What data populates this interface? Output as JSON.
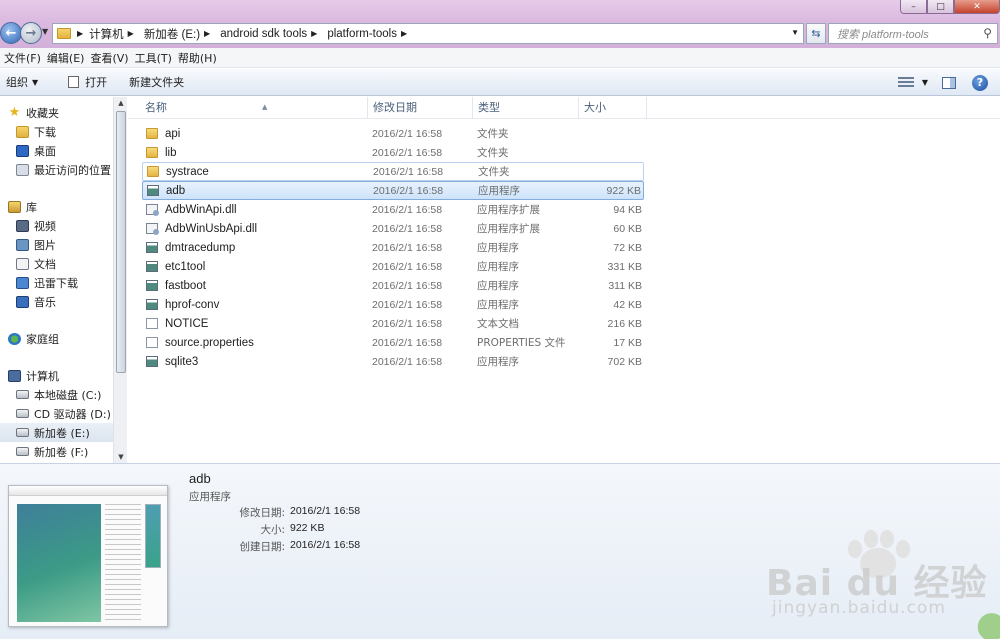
{
  "address": {
    "crumbs": [
      "计算机",
      "新加卷 (E:)",
      "android sdk tools",
      "platform-tools"
    ],
    "search_placeholder": "搜索 platform-tools"
  },
  "menu": [
    "文件(F)",
    "编辑(E)",
    "查看(V)",
    "工具(T)",
    "帮助(H)"
  ],
  "toolbar": {
    "organize": "组织",
    "open": "打开",
    "new_folder": "新建文件夹"
  },
  "sidebar": {
    "favorites_label": "收藏夹",
    "favorites": [
      "下载",
      "桌面",
      "最近访问的位置"
    ],
    "libraries_label": "库",
    "libraries": [
      "视频",
      "图片",
      "文档",
      "迅雷下载",
      "音乐"
    ],
    "homegroup_label": "家庭组",
    "computer_label": "计算机",
    "drives": [
      "本地磁盘 (C:)",
      "CD 驱动器 (D:)",
      "新加卷 (E:)",
      "新加卷 (F:)"
    ]
  },
  "columns": {
    "name": "名称",
    "date": "修改日期",
    "type": "类型",
    "size": "大小"
  },
  "files": [
    {
      "name": "api",
      "date": "2016/2/1 16:58",
      "type": "文件夹",
      "size": "",
      "icon": "folder-icon"
    },
    {
      "name": "lib",
      "date": "2016/2/1 16:58",
      "type": "文件夹",
      "size": "",
      "icon": "folder-icon"
    },
    {
      "name": "systrace",
      "date": "2016/2/1 16:58",
      "type": "文件夹",
      "size": "",
      "icon": "folder-icon"
    },
    {
      "name": "adb",
      "date": "2016/2/1 16:58",
      "type": "应用程序",
      "size": "922 KB",
      "icon": "exe-icon"
    },
    {
      "name": "AdbWinApi.dll",
      "date": "2016/2/1 16:58",
      "type": "应用程序扩展",
      "size": "94 KB",
      "icon": "dll-icon"
    },
    {
      "name": "AdbWinUsbApi.dll",
      "date": "2016/2/1 16:58",
      "type": "应用程序扩展",
      "size": "60 KB",
      "icon": "dll-icon"
    },
    {
      "name": "dmtracedump",
      "date": "2016/2/1 16:58",
      "type": "应用程序",
      "size": "72 KB",
      "icon": "exe-icon"
    },
    {
      "name": "etc1tool",
      "date": "2016/2/1 16:58",
      "type": "应用程序",
      "size": "331 KB",
      "icon": "exe-icon"
    },
    {
      "name": "fastboot",
      "date": "2016/2/1 16:58",
      "type": "应用程序",
      "size": "311 KB",
      "icon": "exe-icon"
    },
    {
      "name": "hprof-conv",
      "date": "2016/2/1 16:58",
      "type": "应用程序",
      "size": "42 KB",
      "icon": "exe-icon"
    },
    {
      "name": "NOTICE",
      "date": "2016/2/1 16:58",
      "type": "文本文档",
      "size": "216 KB",
      "icon": "text-file-icon"
    },
    {
      "name": "source.properties",
      "date": "2016/2/1 16:58",
      "type": "PROPERTIES 文件",
      "size": "17 KB",
      "icon": "text-file-icon"
    },
    {
      "name": "sqlite3",
      "date": "2016/2/1 16:58",
      "type": "应用程序",
      "size": "702 KB",
      "icon": "exe-icon"
    }
  ],
  "selected_file": "adb",
  "details": {
    "name": "adb",
    "type": "应用程序",
    "modified_label": "修改日期:",
    "modified": "2016/2/1 16:58",
    "size_label": "大小:",
    "size": "922 KB",
    "created_label": "创建日期:",
    "created": "2016/2/1 16:58"
  },
  "watermark": {
    "brand": "Bai du 经验",
    "url": "jingyan.baidu.com"
  }
}
